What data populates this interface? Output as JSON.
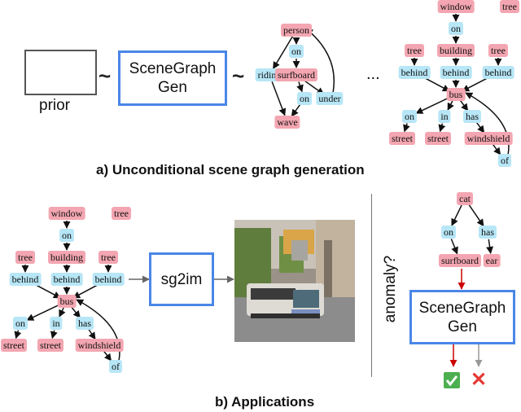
{
  "section_a": {
    "caption": "a) Unconditional scene graph generation",
    "prior_label": "prior",
    "tilde": "~",
    "generator_lines": [
      "SceneGraph",
      "Gen"
    ],
    "ellipsis": "...",
    "graph1": {
      "nodes": [
        {
          "id": "person",
          "label": "person",
          "type": "object"
        },
        {
          "id": "on1",
          "label": "on",
          "type": "relation"
        },
        {
          "id": "riding",
          "label": "riding",
          "type": "relation"
        },
        {
          "id": "surfboard",
          "label": "surfboard",
          "type": "object"
        },
        {
          "id": "on2",
          "label": "on",
          "type": "relation"
        },
        {
          "id": "under",
          "label": "under",
          "type": "relation"
        },
        {
          "id": "wave",
          "label": "wave",
          "type": "object"
        }
      ],
      "edges": [
        [
          "person",
          "on1"
        ],
        [
          "on1",
          "surfboard"
        ],
        [
          "person",
          "riding"
        ],
        [
          "riding",
          "wave"
        ],
        [
          "surfboard",
          "on2"
        ],
        [
          "on2",
          "wave"
        ],
        [
          "surfboard",
          "under"
        ],
        [
          "under",
          "person"
        ]
      ]
    },
    "graph2": {
      "nodes": [
        {
          "id": "window",
          "label": "window",
          "type": "object"
        },
        {
          "id": "tree0",
          "label": "tree",
          "type": "object"
        },
        {
          "id": "on1",
          "label": "on",
          "type": "relation"
        },
        {
          "id": "tree1",
          "label": "tree",
          "type": "object"
        },
        {
          "id": "building",
          "label": "building",
          "type": "object"
        },
        {
          "id": "tree2",
          "label": "tree",
          "type": "object"
        },
        {
          "id": "behind1",
          "label": "behind",
          "type": "relation"
        },
        {
          "id": "behind2",
          "label": "behind",
          "type": "relation"
        },
        {
          "id": "behind3",
          "label": "behind",
          "type": "relation"
        },
        {
          "id": "bus",
          "label": "bus",
          "type": "object"
        },
        {
          "id": "on2",
          "label": "on",
          "type": "relation"
        },
        {
          "id": "in",
          "label": "in",
          "type": "relation"
        },
        {
          "id": "has",
          "label": "has",
          "type": "relation"
        },
        {
          "id": "street1",
          "label": "street",
          "type": "object"
        },
        {
          "id": "street2",
          "label": "street",
          "type": "object"
        },
        {
          "id": "windshield",
          "label": "windshield",
          "type": "object"
        },
        {
          "id": "of",
          "label": "of",
          "type": "relation"
        }
      ]
    }
  },
  "section_b": {
    "caption": "b) Applications",
    "sg2im_label": "sg2im",
    "generated_image_alt": "generated street scene with bus",
    "anomaly_label": "anomaly?",
    "generator_lines": [
      "SceneGraph",
      "Gen"
    ],
    "graph3": {
      "nodes": [
        {
          "id": "cat",
          "label": "cat",
          "type": "object"
        },
        {
          "id": "on",
          "label": "on",
          "type": "relation"
        },
        {
          "id": "has",
          "label": "has",
          "type": "relation"
        },
        {
          "id": "surfboard",
          "label": "surfboard",
          "type": "object"
        },
        {
          "id": "ear",
          "label": "ear",
          "type": "object"
        }
      ]
    },
    "outcomes": {
      "valid_icon": "check-mark-icon",
      "invalid_icon": "cross-mark-icon",
      "cross_glyph": "✕",
      "check_glyph": "✓"
    }
  },
  "colors": {
    "object": "#f3a6b1",
    "relation": "#b7e6f6",
    "box_border": "#4a86e8",
    "prior_fill": "#6d9eeb",
    "red_arrow": "#cc0000",
    "gray_arrow": "#999999"
  }
}
